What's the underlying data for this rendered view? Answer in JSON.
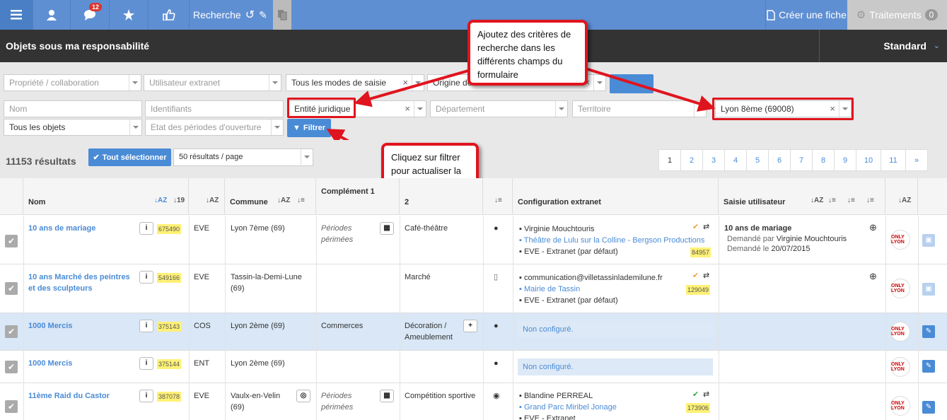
{
  "topbar": {
    "notification_count": "12",
    "search_label": "Recherche",
    "create_label": "Créer une fiche",
    "treatments_label": "Traitements",
    "treatments_count": "0"
  },
  "header": {
    "title": "Objets sous ma responsabilité",
    "view": "Standard"
  },
  "filters": {
    "propriete": "Propriété / collaboration",
    "utilisateur": "Utilisateur extranet",
    "modes": "Tous les modes de saisie",
    "origine": "Origine de",
    "nom": "Nom",
    "identifiants": "Identifiants",
    "entite": "Entité juridique",
    "departement": "Département",
    "territoire": "Territoire",
    "commune": "Lyon 8ème (69008)",
    "objets": "Tous les objets",
    "periodes": "Etat des périodes d'ouverture",
    "filtrer": "Filtrer"
  },
  "callouts": {
    "add_criteria": "Ajoutez des critères de recherche dans les différents champs du formulaire",
    "click_filter": "Cliquez sur filtrer pour actualiser la liste de résultats"
  },
  "results": {
    "count": "11153 résultats",
    "select_all": "Tout sélectionner",
    "per_page": "50 résultats / page",
    "pages": [
      "1",
      "2",
      "3",
      "4",
      "5",
      "6",
      "7",
      "8",
      "9",
      "10",
      "11",
      "»"
    ]
  },
  "columns": {
    "nom": "Nom",
    "commune": "Commune",
    "complement1": "Complément 1",
    "complement2": "2",
    "config": "Configuration extranet",
    "saisie": "Saisie utilisateur"
  },
  "rows": [
    {
      "name": "10 ans de mariage",
      "id": "675490",
      "type": "EVE",
      "commune": "Lyon 7ème (69)",
      "comp1": "Périodes périmées",
      "comp2": "Café-théâtre",
      "config_user": "Virginie Mouchtouris",
      "config_link": "Théâtre de Lulu sur la Colline - Bergson Productions",
      "config_ext": "EVE - Extranet (par défaut)",
      "config_id": "84957",
      "saisie_title": "10 ans de mariage",
      "saisie_by_label": "Demandé par",
      "saisie_by": "Virginie Mouchtouris",
      "saisie_on_label": "Demandé le",
      "saisie_on": "20/07/2015"
    },
    {
      "name": "10 ans Marché des peintres et des sculpteurs",
      "id": "549166",
      "type": "EVE",
      "commune": "Tassin-la-Demi-Lune (69)",
      "comp2": "Marché",
      "config_user": "communication@villetassinlademilune.fr",
      "config_link": "Mairie de Tassin",
      "config_ext": "EVE - Extranet (par défaut)",
      "config_id": "129049"
    },
    {
      "name": "1000 Mercis",
      "id": "375143",
      "type": "COS",
      "commune": "Lyon 2ème (69)",
      "comp1": "Commerces",
      "comp2": "Décoration / Ameublement",
      "config_none": "Non configuré."
    },
    {
      "name": "1000 Mercis",
      "id": "375144",
      "type": "ENT",
      "commune": "Lyon 2ème (69)",
      "config_none": "Non configuré."
    },
    {
      "name": "11ème Raid du Castor",
      "id": "387078",
      "type": "EVE",
      "commune": "Vaulx-en-Velin (69)",
      "comp1": "Périodes périmées",
      "comp2": "Compétition sportive",
      "config_user": "Blandine PERREAL",
      "config_link": "Grand Parc Miribel Jonage",
      "config_ext": "EVE - Extranet",
      "config_id": "173906"
    }
  ],
  "logo_text": "ONLY LYON",
  "colors": {
    "accent": "#5f8fd3",
    "header": "#333333",
    "callout_border": "#e0141e",
    "link": "#4a8bd6"
  }
}
